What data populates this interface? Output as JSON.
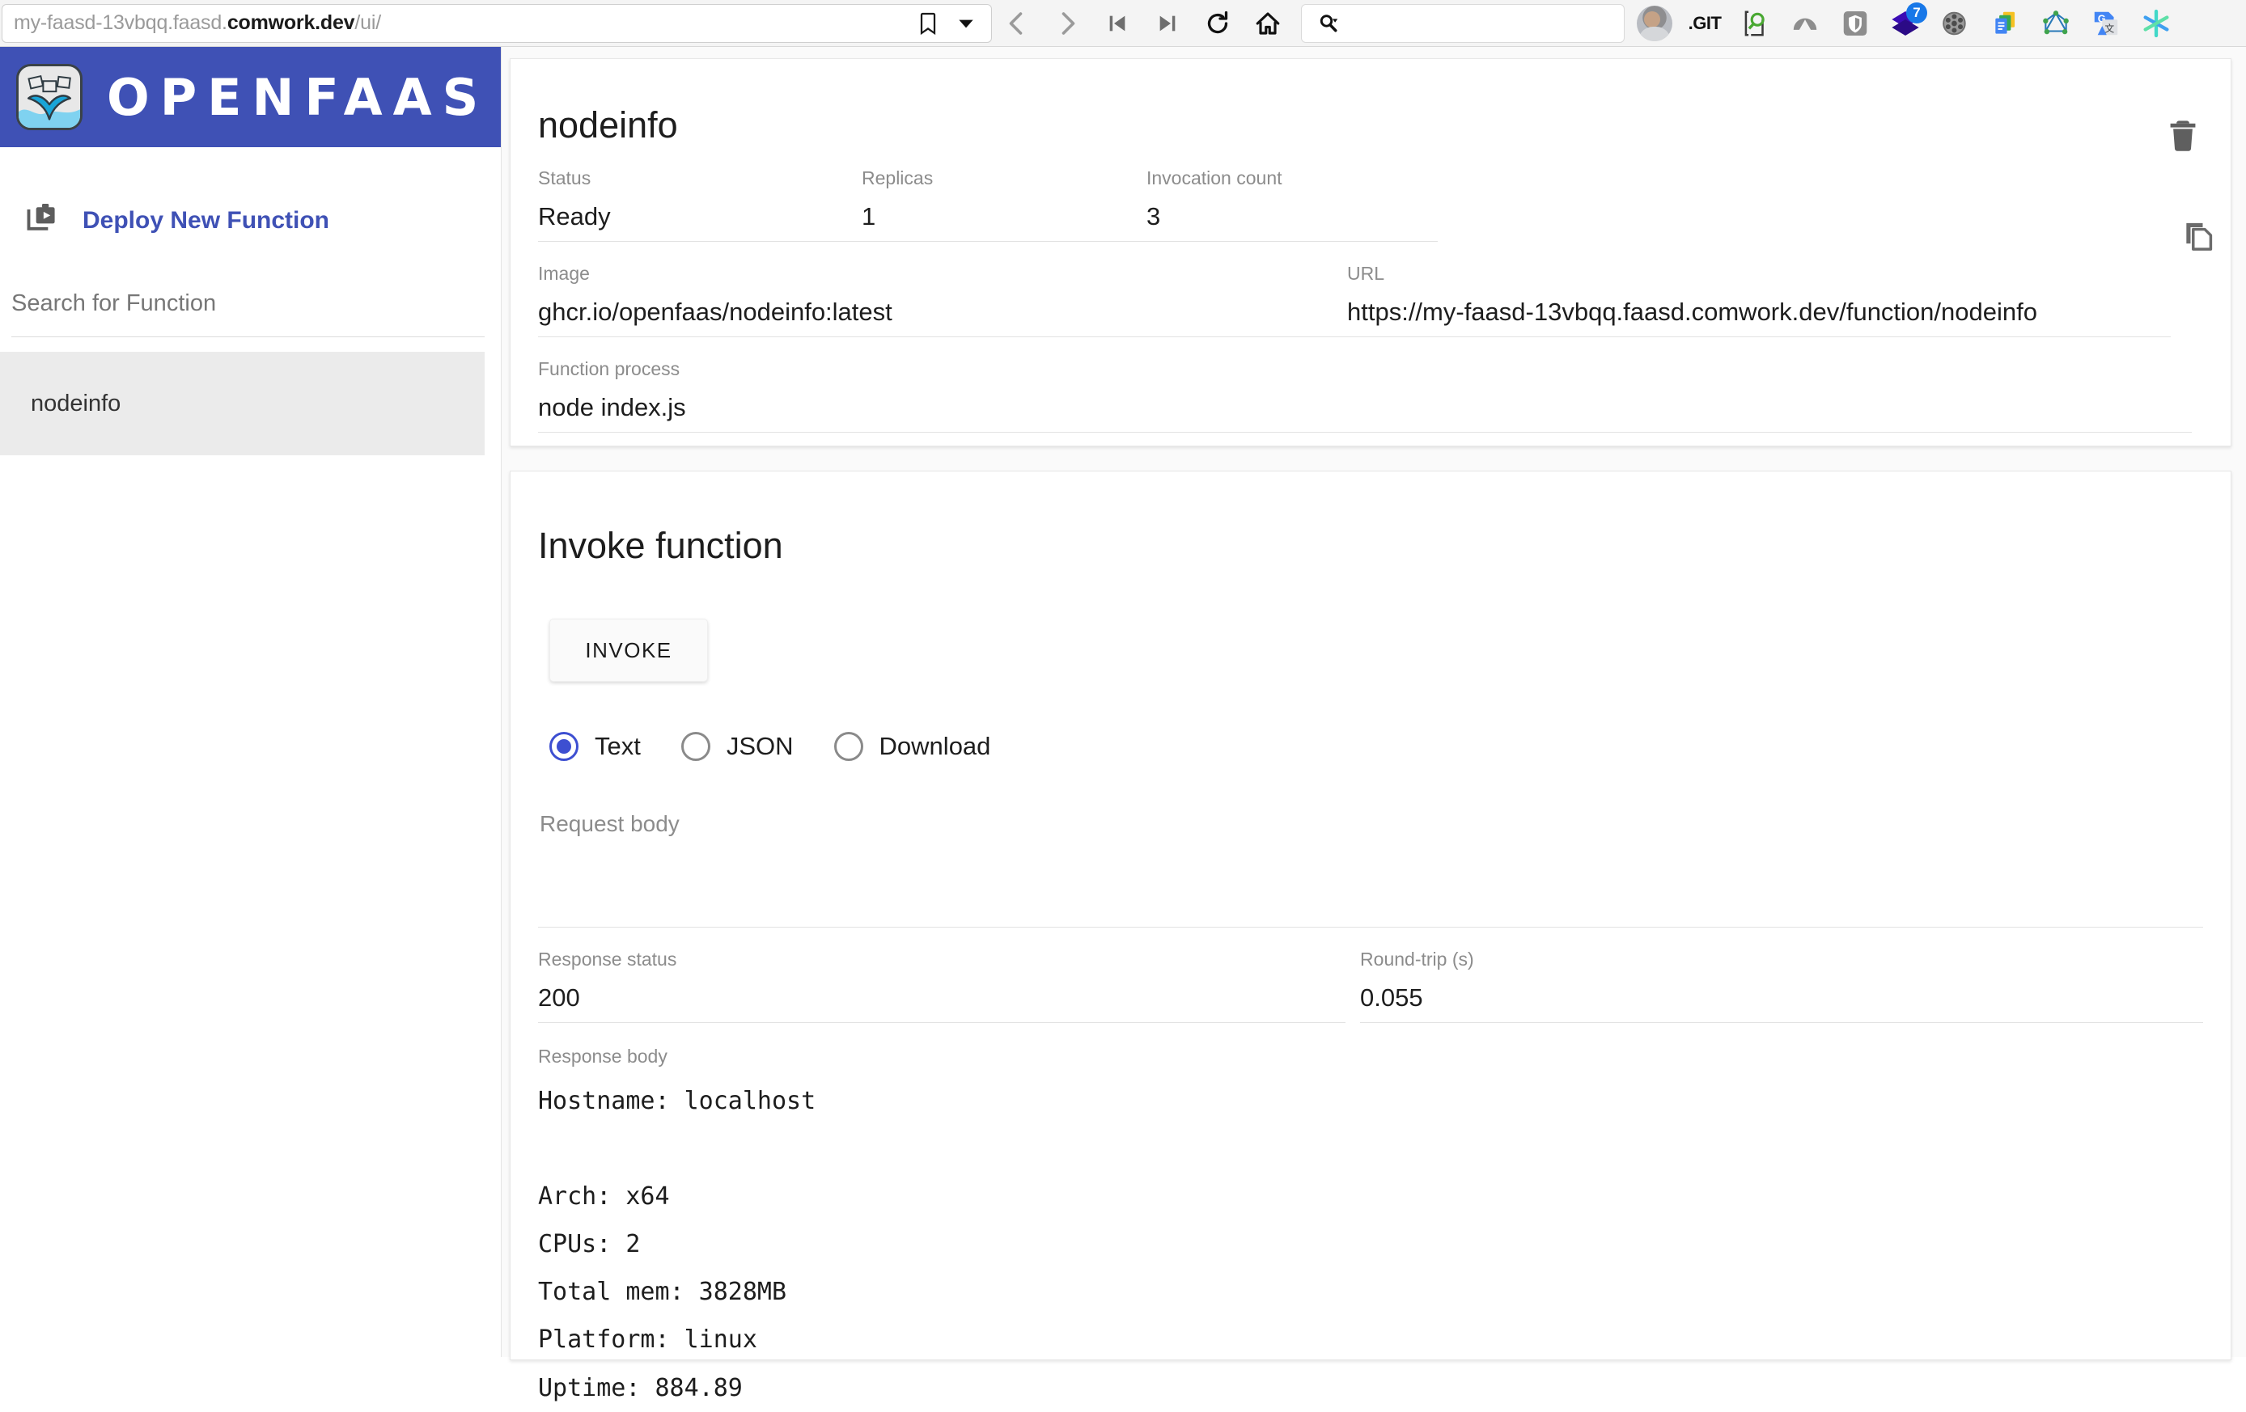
{
  "browser": {
    "url_prefix": "my-faasd-13vbqq.faasd.",
    "url_domain": "comwork.dev",
    "url_suffix": "/ui/",
    "search_value": "",
    "search_placeholder": "",
    "git_label": ".GIT",
    "badge_count": "7",
    "icons": [
      "bookmark-icon",
      "chevron-down-icon",
      "back-icon",
      "forward-icon",
      "skip-start-icon",
      "skip-end-icon",
      "reload-icon",
      "home-icon",
      "search-icon",
      "avatar-icon",
      "git-icon",
      "json-viewer-icon",
      "nordvpn-icon",
      "bitwarden-shield-icon",
      "layers-icon",
      "film-reel-icon",
      "google-docs-icon",
      "graphql-icon",
      "google-translate-icon",
      "asterisk-icon"
    ]
  },
  "sidebar": {
    "brand": "OPENFAAS",
    "deploy_label": "Deploy New Function",
    "search_placeholder": "Search for Function",
    "functions": [
      {
        "name": "nodeinfo",
        "selected": true
      }
    ]
  },
  "details": {
    "title": "nodeinfo",
    "fields": [
      {
        "label": "Status",
        "value": "Ready"
      },
      {
        "label": "Replicas",
        "value": "1"
      },
      {
        "label": "Invocation count",
        "value": "3"
      }
    ],
    "image_label": "Image",
    "image_value": "ghcr.io/openfaas/nodeinfo:latest",
    "url_label": "URL",
    "url_value": "https://my-faasd-13vbqq.faasd.comwork.dev/function/nodeinfo",
    "process_label": "Function process",
    "process_value": "node index.js"
  },
  "invoke": {
    "title": "Invoke function",
    "button_label": "INVOKE",
    "modes": [
      {
        "label": "Text",
        "selected": true
      },
      {
        "label": "JSON",
        "selected": false
      },
      {
        "label": "Download",
        "selected": false
      }
    ],
    "request_body_label": "Request body",
    "request_body_value": "",
    "response_status_label": "Response status",
    "response_status_value": "200",
    "round_trip_label": "Round-trip (s)",
    "round_trip_value": "0.055",
    "response_body_label": "Response body",
    "response_body_value": "Hostname: localhost\n\nArch: x64\nCPUs: 2\nTotal mem: 3828MB\nPlatform: linux\nUptime: 884.89"
  },
  "colors": {
    "brand_indigo": "#3f51b5",
    "link_blue": "#3f51b5",
    "radio_blue": "#3d4fd1",
    "page_bg": "#fafafa"
  }
}
